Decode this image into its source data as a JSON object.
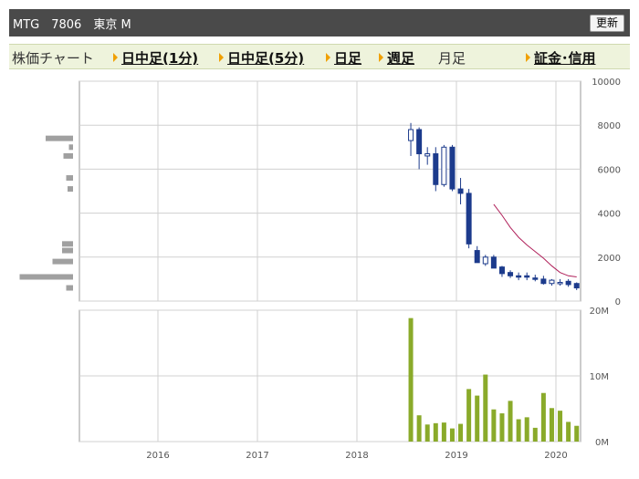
{
  "header": {
    "title": "MTG　7806　東京 M",
    "refresh_label": "更新"
  },
  "nav": {
    "chart_label": "株価チャート",
    "intraday_1m": "日中足(1分)",
    "intraday_5m": "日中足(5分)",
    "daily": "日足",
    "weekly": "週足",
    "monthly": "月足",
    "margin": "証金･信用"
  },
  "colors": {
    "candle_down": "#1c3b8c",
    "candle_up_fill": "#ffffff",
    "moving_average": "#b0205a",
    "volume_bar": "#8aaa2a",
    "volume_profile": "#a0a0a0",
    "nav_arrow": "#f0a000"
  },
  "chart_data": [
    {
      "type": "candlestick",
      "interval": "monthly",
      "x": [
        "2018-07",
        "2018-08",
        "2018-09",
        "2018-10",
        "2018-11",
        "2018-12",
        "2019-01",
        "2019-02",
        "2019-03",
        "2019-04",
        "2019-05",
        "2019-06",
        "2019-07",
        "2019-08",
        "2019-09",
        "2019-10",
        "2019-11",
        "2019-12",
        "2020-01",
        "2020-02",
        "2020-03"
      ],
      "open": [
        7300,
        7800,
        6600,
        6700,
        5300,
        7000,
        5100,
        4900,
        2300,
        1700,
        2000,
        1550,
        1300,
        1150,
        1150,
        1050,
        1000,
        800,
        800,
        900,
        800
      ],
      "high": [
        8100,
        7900,
        7000,
        7000,
        7100,
        7100,
        5600,
        5100,
        2500,
        2100,
        2100,
        1600,
        1400,
        1300,
        1300,
        1200,
        1150,
        1000,
        1000,
        1000,
        850
      ],
      "low": [
        6600,
        6000,
        6200,
        5000,
        5200,
        5000,
        4400,
        2400,
        1800,
        1600,
        1600,
        1100,
        1050,
        950,
        950,
        900,
        750,
        700,
        700,
        650,
        500
      ],
      "close": [
        7800,
        6700,
        6700,
        5300,
        7000,
        5100,
        4900,
        2600,
        1750,
        2000,
        1500,
        1250,
        1150,
        1100,
        1100,
        1000,
        800,
        950,
        850,
        750,
        600
      ],
      "moving_average": {
        "x": [
          "2019-05",
          "2019-06",
          "2019-07",
          "2019-08",
          "2019-09",
          "2019-10",
          "2019-11",
          "2019-12",
          "2020-01",
          "2020-02",
          "2020-03"
        ],
        "values": [
          4400,
          3900,
          3350,
          2900,
          2550,
          2250,
          1950,
          1600,
          1300,
          1150,
          1100
        ]
      },
      "x_ticks": [
        "2016",
        "2017",
        "2018",
        "2019",
        "2020"
      ],
      "y_ticks": [
        "0",
        "2000",
        "4000",
        "6000",
        "8000",
        "10000"
      ],
      "ylim": [
        0,
        10000
      ],
      "volume_profile": [
        {
          "price": 7400,
          "volume": 1.0
        },
        {
          "price": 7000,
          "volume": 0.15
        },
        {
          "price": 6600,
          "volume": 0.35
        },
        {
          "price": 5600,
          "volume": 0.25
        },
        {
          "price": 5100,
          "volume": 0.2
        },
        {
          "price": 2600,
          "volume": 0.4
        },
        {
          "price": 2300,
          "volume": 0.4
        },
        {
          "price": 1800,
          "volume": 0.75
        },
        {
          "price": 1100,
          "volume": 1.95
        },
        {
          "price": 600,
          "volume": 0.25
        }
      ],
      "grid": true
    },
    {
      "type": "bar",
      "name": "volume",
      "x": [
        "2018-07",
        "2018-08",
        "2018-09",
        "2018-10",
        "2018-11",
        "2018-12",
        "2019-01",
        "2019-02",
        "2019-03",
        "2019-04",
        "2019-05",
        "2019-06",
        "2019-07",
        "2019-08",
        "2019-09",
        "2019-10",
        "2019-11",
        "2019-12",
        "2020-01",
        "2020-02",
        "2020-03"
      ],
      "values": [
        18.8,
        4.0,
        2.6,
        2.8,
        2.9,
        2.0,
        2.7,
        8.0,
        7.0,
        10.2,
        4.9,
        4.3,
        6.2,
        3.4,
        3.7,
        2.1,
        7.4,
        5.1,
        4.7,
        3.0,
        2.4
      ],
      "unit": "M",
      "y_ticks": [
        "0M",
        "10M",
        "20M"
      ],
      "ylim": [
        0,
        20
      ],
      "grid": true
    }
  ]
}
